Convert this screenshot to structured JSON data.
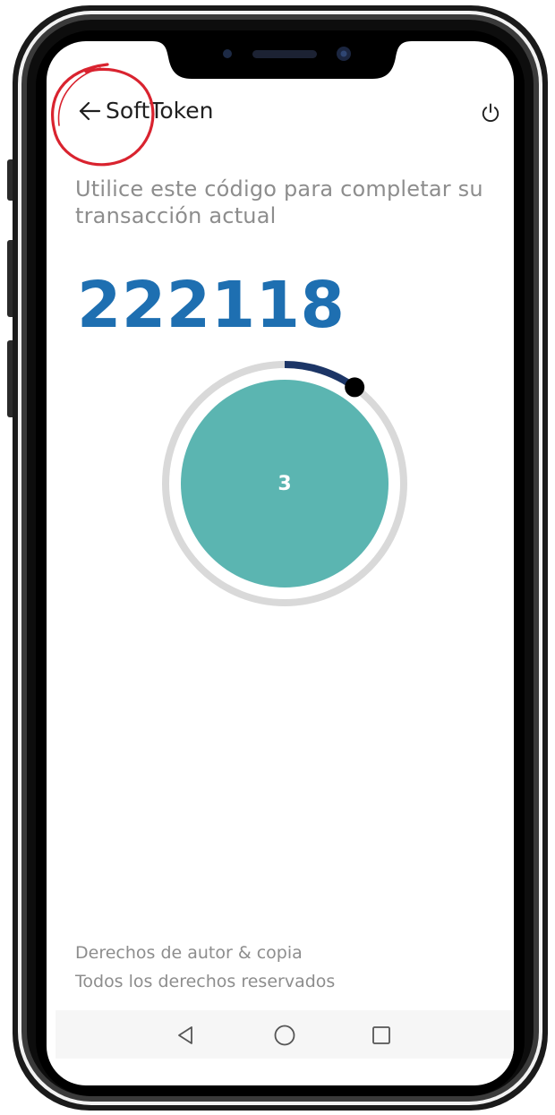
{
  "app": {
    "title": "SoftToken"
  },
  "instruction": "Utilice este código para completar su transacción actual",
  "token": {
    "code": "222118",
    "seconds_remaining": "3",
    "progress_fraction": 0.1
  },
  "footer": {
    "line1": "Derechos de autor & copia",
    "line2": "Todos los derechos reservados"
  },
  "colors": {
    "code": "#1e6fb1",
    "timer_fill": "#5bb5b1",
    "timer_ring": "#d9d9d9",
    "timer_arc": "#1c3566",
    "annotation": "#d9232f"
  },
  "icons": {
    "back": "arrow-left-icon",
    "power": "power-icon",
    "nav_back": "triangle-back-icon",
    "nav_home": "circle-home-icon",
    "nav_recent": "square-recent-icon"
  }
}
